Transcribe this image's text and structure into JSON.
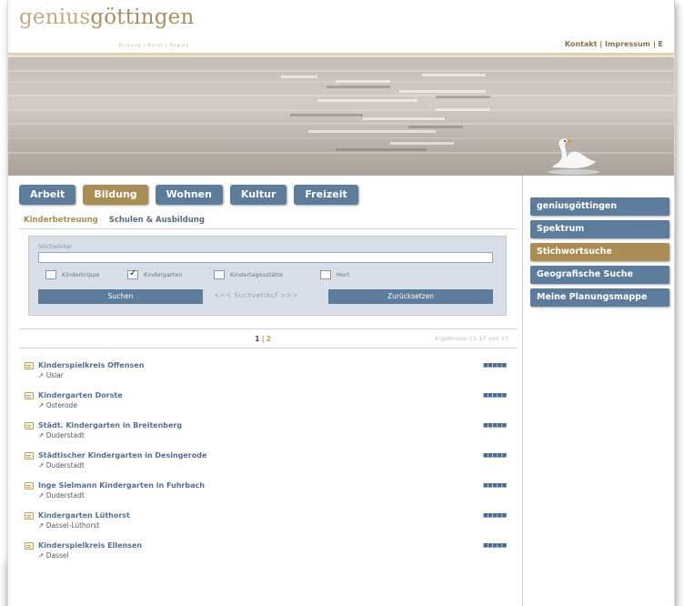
{
  "header": {
    "logo_part1": "genius",
    "logo_part2": "göttingen",
    "tagline": "Bildung | Beruf | Region",
    "nav": [
      {
        "label": "Kontakt"
      },
      {
        "label": "Impressum"
      },
      {
        "label": "E"
      }
    ],
    "nav_separator": "|"
  },
  "tabs": [
    {
      "label": "Arbeit",
      "active": false
    },
    {
      "label": "Bildung",
      "active": true
    },
    {
      "label": "Wohnen",
      "active": false
    },
    {
      "label": "Kultur",
      "active": false
    },
    {
      "label": "Freizeit",
      "active": false
    }
  ],
  "subtabs": [
    {
      "label": "Kinderbetreuung",
      "active": true
    },
    {
      "label": "Schulen & Ausbildung",
      "active": false
    }
  ],
  "search": {
    "label": "Stichwörter",
    "value": "",
    "checkboxes": [
      {
        "label": "Kinderkrippe",
        "checked": false
      },
      {
        "label": "Kindergarten",
        "checked": true
      },
      {
        "label": "Kindertagesstätte",
        "checked": false
      },
      {
        "label": "Hort",
        "checked": false
      }
    ],
    "search_button": "Suchen",
    "mid_text": "<<< Suchverlauf >>>",
    "reset_button": "Zurücksetzen"
  },
  "pager": {
    "pages": [
      "1",
      "2"
    ],
    "separator": "|",
    "current_page": 1,
    "results_text": "Ergebnisse 11-17 von 17"
  },
  "results": [
    {
      "title": "Kinderspielkreis Offensen",
      "location": "Uslar",
      "rating": "■■■■■"
    },
    {
      "title": "Kindergarten Dorste",
      "location": "Osterode",
      "rating": "■■■■■"
    },
    {
      "title": "Städt. Kindergarten in Breitenberg",
      "location": "Duderstadt",
      "rating": "■■■■■"
    },
    {
      "title": "Städtischer Kindergarten in Desingerode",
      "location": "Duderstadt",
      "rating": "■■■■■"
    },
    {
      "title": "Inge Sielmann Kindergarten in Fuhrbach",
      "location": "Duderstadt",
      "rating": "■■■■■"
    },
    {
      "title": "Kindergarten Lüthorst",
      "location": "Dassel-Lüthorst",
      "rating": "■■■■■"
    },
    {
      "title": "Kinderspielkreis Ellensen",
      "location": "Dassel",
      "rating": "■■■■■"
    }
  ],
  "location_prefix": "↗",
  "sidebar": [
    {
      "label": "geniusgöttingen",
      "active": false
    },
    {
      "label": "Spektrum",
      "active": false
    },
    {
      "label": "Stichwortsuche",
      "active": true
    },
    {
      "label": "Geografische Suche",
      "active": false
    },
    {
      "label": "Meine Planungsmappe",
      "active": false
    }
  ],
  "colors": {
    "nav_blue": "#5d7b9b",
    "gold": "#a98d55",
    "link_blue": "#526f91"
  }
}
